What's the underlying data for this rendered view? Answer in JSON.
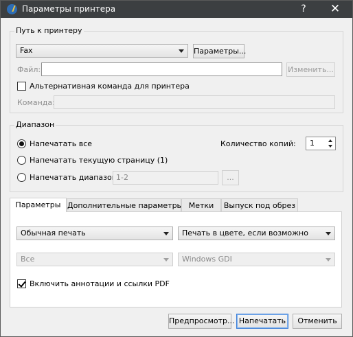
{
  "window": {
    "title": "Параметры принтера",
    "help_label": "?",
    "close_label": "✕"
  },
  "printer_path": {
    "group_title": "Путь к принтеру",
    "printer_selected": "Fax",
    "params_button": "Параметры...",
    "file_label": "Файл:",
    "file_value": "",
    "change_button": "Изменить...",
    "alt_command_label": "Альтернативная команда для принтера",
    "alt_command_checked": false,
    "command_label": "Команда:",
    "command_value": ""
  },
  "range": {
    "group_title": "Диапазон",
    "options": [
      {
        "label": "Напечатать все",
        "selected": true
      },
      {
        "label": "Напечатать текущую страницу (1)",
        "selected": false
      },
      {
        "label": "Напечатать диапазон",
        "selected": false
      }
    ],
    "range_placeholder": "1-2",
    "range_button": "...",
    "copies_label": "Количество копий:",
    "copies_value": "1"
  },
  "tabs": [
    {
      "label": "Параметры",
      "active": true
    },
    {
      "label": "Дополнительные параметры",
      "active": false
    },
    {
      "label": "Метки",
      "active": false
    },
    {
      "label": "Выпуск под обрез",
      "active": false
    }
  ],
  "params_tab": {
    "print_mode": "Обычная печать",
    "color_mode": "Печать в цвете, если возможно",
    "pages_selection": "Все",
    "driver": "Windows GDI",
    "include_annotations_label": "Включить аннотации и ссылки PDF",
    "include_annotations_checked": true
  },
  "footer": {
    "preview_button": "Предпросмотр...",
    "print_button": "Напечатать",
    "cancel_button": "Отменить"
  },
  "colors": {
    "titlebar": "#3c3f41",
    "dialog_bg": "#f0f0f0",
    "default_button_border": "#3c7fd9"
  }
}
